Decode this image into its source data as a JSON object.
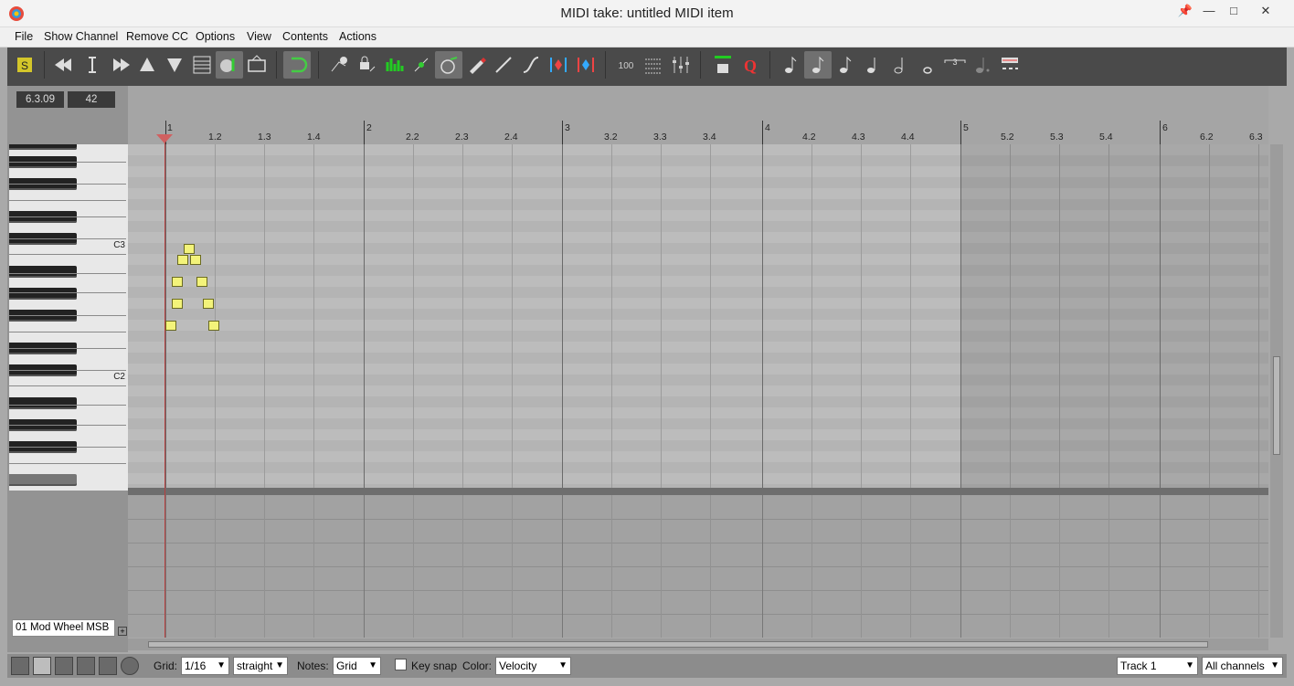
{
  "window": {
    "title": "MIDI take: untitled MIDI item"
  },
  "menu": [
    "File",
    "Show Channel",
    "Remove CC",
    "Options",
    "View",
    "Contents",
    "Actions"
  ],
  "toolbar": {
    "solo_label": "S",
    "velocity_value": "100"
  },
  "position": {
    "time": "6.3.09",
    "pitch": "42"
  },
  "ruler": {
    "bars": [
      "1",
      "2",
      "3",
      "4",
      "5",
      "6"
    ],
    "beats": [
      "1.2",
      "1.3",
      "1.4",
      "2.2",
      "2.3",
      "2.4",
      "3.2",
      "3.3",
      "3.4",
      "4.2",
      "4.3",
      "4.4",
      "5.2",
      "5.3",
      "5.4",
      "6.2",
      "6.3"
    ]
  },
  "piano": {
    "label_c3": "C3",
    "label_c2": "C2"
  },
  "cc_lane": {
    "selected": "01 Mod Wheel MSB"
  },
  "status": {
    "grid_label": "Grid:",
    "grid_value": "1/16",
    "grid_type": "straight",
    "notes_label": "Notes:",
    "notes_value": "Grid",
    "keysnap_label": "Key snap",
    "color_label": "Color:",
    "color_value": "Velocity",
    "track_value": "Track 1",
    "channel_value": "All channels"
  },
  "colors": {
    "note_fill": "#f3f37a",
    "playhead": "#d06060",
    "toolbar_bg": "#4a4a4a"
  }
}
